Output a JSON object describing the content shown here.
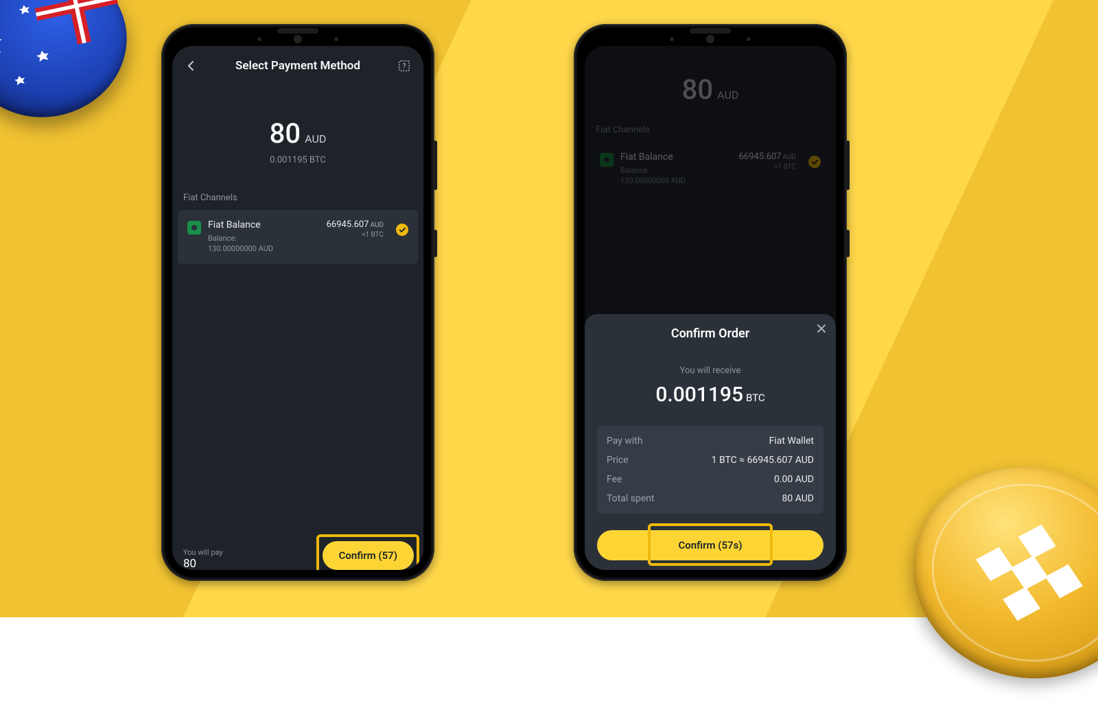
{
  "left": {
    "title": "Select Payment Method",
    "amount_value": "80",
    "amount_currency": "AUD",
    "amount_sub": "0.001195 BTC",
    "section_label": "Fiat Channels",
    "channel": {
      "name": "Fiat Balance",
      "balance_label": "Balance:",
      "balance_value": "130.00000000 AUD",
      "price_value": "66945.607",
      "price_unit": "AUD",
      "per_unit": "≈1 BTC"
    },
    "footer_label": "You will pay",
    "footer_value": "80",
    "confirm_label": "Confirm (57)"
  },
  "right": {
    "amount_value": "80",
    "amount_currency": "AUD",
    "section_label": "Fiat Channels",
    "channel": {
      "name": "Fiat Balance",
      "balance_label": "Balance:",
      "balance_value": "130.00000000 AUD",
      "price_value": "66945.607",
      "price_unit": "AUD",
      "per_unit": "≈1 BTC"
    },
    "sheet": {
      "title": "Confirm Order",
      "receive_label": "You will receive",
      "receive_value": "0.001195",
      "receive_unit": "BTC",
      "rows": {
        "pay_with_k": "Pay with",
        "pay_with_v": "Fiat Wallet",
        "price_k": "Price",
        "price_v": "1 BTC ≈ 66945.607 AUD",
        "fee_k": "Fee",
        "fee_v": "0.00 AUD",
        "total_k": "Total spent",
        "total_v": "80 AUD"
      },
      "confirm_label": "Confirm (57s)"
    }
  }
}
